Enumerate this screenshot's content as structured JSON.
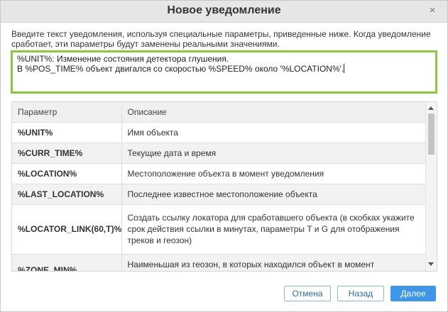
{
  "dialog": {
    "title": "Новое уведомление",
    "close_icon": "close-icon",
    "intro_text": "Введите текст уведомления, используя специальные параметры, приведенные ниже. Когда уведомление сработает, эти параметры будут заменены реальными значениями.",
    "editor_text": "%UNIT%: Изменение состояния детектора глушения.\nВ %POS_TIME% объект двигался со скоростью %SPEED% около '%LOCATION%'."
  },
  "table": {
    "headers": {
      "param": "Параметр",
      "desc": "Описание"
    },
    "rows": [
      {
        "param": "%UNIT%",
        "desc": "Имя объекта"
      },
      {
        "param": "%CURR_TIME%",
        "desc": "Текущие дата и время"
      },
      {
        "param": "%LOCATION%",
        "desc": "Местоположение объекта в момент уведомления"
      },
      {
        "param": "%LAST_LOCATION%",
        "desc": "Последнее известное местоположение объекта"
      },
      {
        "param": "%LOCATOR_LINK(60,T)%",
        "desc": "Создать ссылку локатора для сработавшего объекта (в скобках укажите срок действия ссылки в минутах, параметры T и G для отображения треков и геозон)"
      },
      {
        "param": "%ZONE_MIN%",
        "desc": "Наименьшая из геозон, в которых находился объект в момент уведомления"
      }
    ]
  },
  "buttons": {
    "cancel": "Отмена",
    "back": "Назад",
    "next": "Далее"
  },
  "colors": {
    "editor_border": "#8dc63f",
    "primary_button": "#3d96e6"
  }
}
